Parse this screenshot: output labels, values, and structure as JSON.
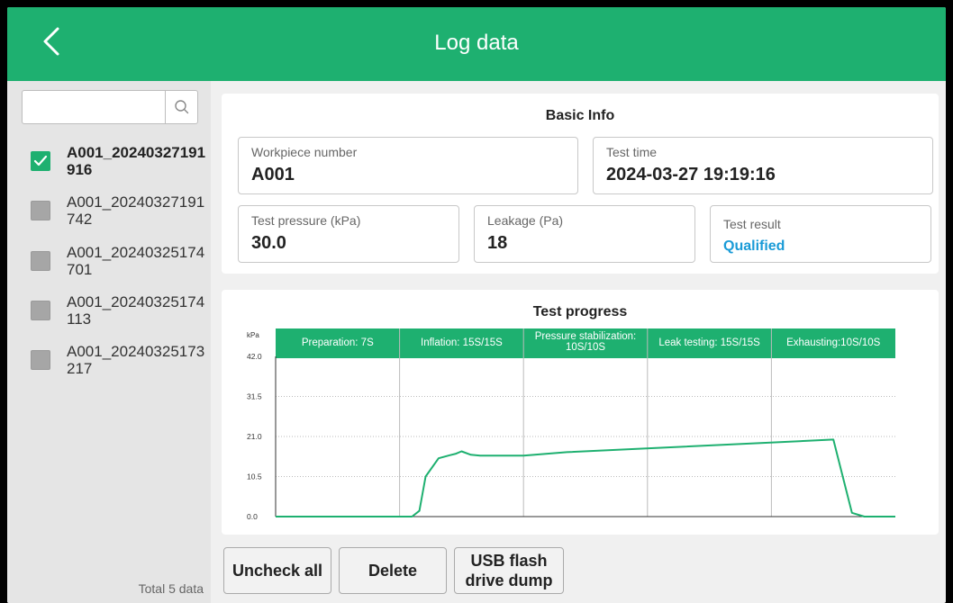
{
  "header": {
    "title": "Log data",
    "back_icon": "chevron-left-icon"
  },
  "sidebar": {
    "search": {
      "placeholder": "",
      "value": "",
      "icon": "search-icon"
    },
    "items": [
      {
        "label": "A001_20240327191916",
        "checked": true
      },
      {
        "label": "A001_20240327191742",
        "checked": false
      },
      {
        "label": "A001_20240325174701",
        "checked": false
      },
      {
        "label": "A001_20240325174113",
        "checked": false
      },
      {
        "label": "A001_20240325173217",
        "checked": false
      }
    ],
    "total": "Total 5 data"
  },
  "basic_info": {
    "title": "Basic Info",
    "workpiece_number": {
      "label": "Workpiece number",
      "value": "A001"
    },
    "test_time": {
      "label": "Test time",
      "value": "2024-03-27 19:19:16"
    },
    "test_pressure": {
      "label": "Test pressure (kPa)",
      "value": "30.0"
    },
    "leakage": {
      "label": "Leakage (Pa)",
      "value": "18"
    },
    "test_result": {
      "label": "Test result",
      "value": "Qualified"
    }
  },
  "test_progress": {
    "title": "Test progress"
  },
  "chart_data": {
    "type": "line",
    "title": "Test progress",
    "ylabel": "kPa",
    "ylim": [
      0,
      42
    ],
    "yticks": [
      "42.0",
      "31.5",
      "21.0",
      "10.5",
      "0.0"
    ],
    "phases": [
      "Preparation: 7S",
      "Inflation: 15S/15S",
      "Pressure stabilization: 10S/10S",
      "Leak testing: 15S/15S",
      "Exhausting:10S/10S"
    ],
    "grid": true,
    "series": [
      {
        "color": "#1eb070",
        "x": [
          0,
          0.22,
          0.232,
          0.242,
          0.263,
          0.281,
          0.291,
          0.3,
          0.315,
          0.33,
          0.4,
          0.47,
          0.9,
          0.93,
          0.95,
          1.0
        ],
        "y": [
          0,
          0,
          1.5,
          10.5,
          15.3,
          16.1,
          16.5,
          17.1,
          16.2,
          16.0,
          16.0,
          16.9,
          20.2,
          1.0,
          0,
          0
        ]
      }
    ]
  },
  "buttons": {
    "uncheck_all": "Uncheck all",
    "delete": "Delete",
    "usb_line1": "USB flash",
    "usb_line2": "drive dump"
  },
  "colors": {
    "accent": "#1eb070",
    "qualified": "#1a9bd7"
  }
}
